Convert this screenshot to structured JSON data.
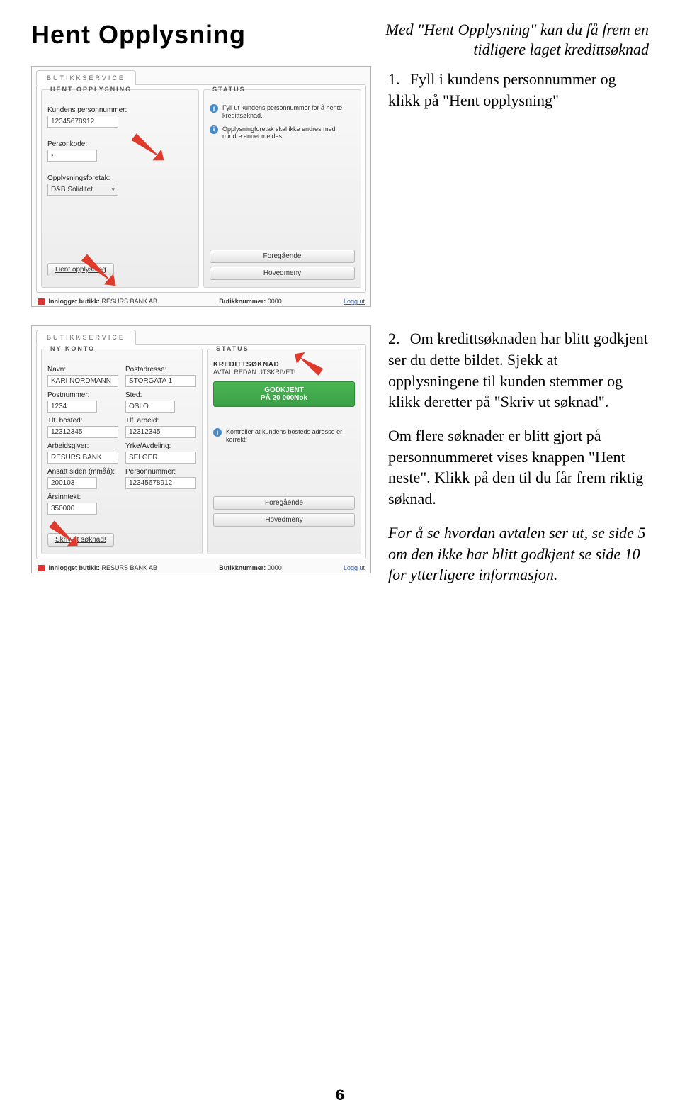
{
  "header": {
    "title": "Hent Opplysning",
    "tagline_l1": "Med \"Hent Opplysning\" kan du få frem en",
    "tagline_l2": "tidligere laget kredittsøknad"
  },
  "step1": "Fyll i kundens personnummer og klikk på \"Hent opplysning\"",
  "step2": {
    "p1": "Om kredittsøknaden har blitt godkjent ser du dette bildet. Sjekk at opplysningene til kunden stemmer og klikk deretter på \"Skriv ut søknad\".",
    "p2": "Om flere søknader er blitt gjort på personnummeret vises knappen \"Hent neste\". Klikk på den til du får frem riktig søknad.",
    "p3": "For å se hvordan avtalen ser ut, se side 5 om den ikke har blitt godkjent se side 10 for ytterligere informasjon."
  },
  "shot1": {
    "tab": "BUTIKKSERVICE",
    "left_title": "HENT OPPLYSNING",
    "right_title": "STATUS",
    "personnummer_label": "Kundens personnummer:",
    "personnummer_value": "12345678912",
    "personkode_label": "Personkode:",
    "personkode_value": "•",
    "foretak_label": "Opplysningsforetak:",
    "foretak_value": "D&B Soliditet",
    "info1": "Fyll ut kundens personnummer for å hente kredittsøknad.",
    "info2": "Opplysningforetak skal ikke endres med mindre annet meldes.",
    "btn_hent": "Hent opplysning",
    "btn_prev": "Foregående",
    "btn_main": "Hovedmeny",
    "footer_shop": "Innlogget butikk:",
    "footer_shop_val": "RESURS BANK AB",
    "footer_num": "Butikknummer:",
    "footer_num_val": "0000",
    "logout": "Logg ut"
  },
  "shot2": {
    "tab": "BUTIKKSERVICE",
    "left_title": "NY KONTO",
    "right_title": "STATUS",
    "status_hdr": "KREDITTSØKNAD",
    "status_sub": "AVTAL REDAN UTSKRIVET!",
    "approved_l1": "GODKJENT",
    "approved_l2": "PÅ 20 000Nok",
    "info1": "Kontroller at kundens bosteds adresse er korrekt!",
    "navn_label": "Navn:",
    "navn_value": "KARI NORDMANN",
    "post_label": "Postadresse:",
    "post_value": "STORGATA 1",
    "pnr_label": "Postnummer:",
    "pnr_value": "1234",
    "sted_label": "Sted:",
    "sted_value": "OSLO",
    "tlfb_label": "Tlf. bosted:",
    "tlfb_value": "12312345",
    "tlfa_label": "Tlf. arbeid:",
    "tlfa_value": "12312345",
    "arb_label": "Arbeidsgiver:",
    "arb_value": "RESURS BANK",
    "yrke_label": "Yrke/Avdeling:",
    "yrke_value": "SELGER",
    "ans_label": "Ansatt siden (mmåå):",
    "ans_value": "200103",
    "pers_label": "Personnummer:",
    "pers_value": "12345678912",
    "inn_label": "Årsinntekt:",
    "inn_value": "350000",
    "btn_skriv": "Skriv ut søknad!",
    "btn_prev": "Foregående",
    "btn_main": "Hovedmeny",
    "footer_shop": "Innlogget butikk:",
    "footer_shop_val": "RESURS BANK AB",
    "footer_num": "Butikknummer:",
    "footer_num_val": "0000",
    "logout": "Logg ut"
  },
  "page_number": "6"
}
